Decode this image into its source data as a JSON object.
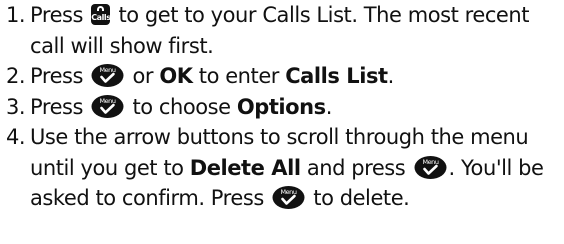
{
  "steps": [
    {
      "number": "1.",
      "calls_icon_label": "Calls",
      "parts": {
        "a": "Press",
        "b": "to get to your Calls List. The most recent call will show first."
      }
    },
    {
      "number": "2.",
      "parts": {
        "a": "Press",
        "b": "or",
        "ok": "OK",
        "c": "to enter",
        "calls_list": "Calls List",
        "d": "."
      }
    },
    {
      "number": "3.",
      "parts": {
        "a": "Press",
        "b": "to choose",
        "options": "Options",
        "c": "."
      }
    },
    {
      "number": "4.",
      "parts": {
        "a": "Use the arrow buttons to scroll through the menu until you get to",
        "delete_all": "Delete All",
        "b": "and press",
        "c": ". You'll be asked to confirm. Press",
        "d": "to delete."
      }
    }
  ],
  "icons": {
    "menu_ok": "menu-ok-key-icon",
    "calls": "calls-key-icon",
    "menu_label": "Menu"
  }
}
